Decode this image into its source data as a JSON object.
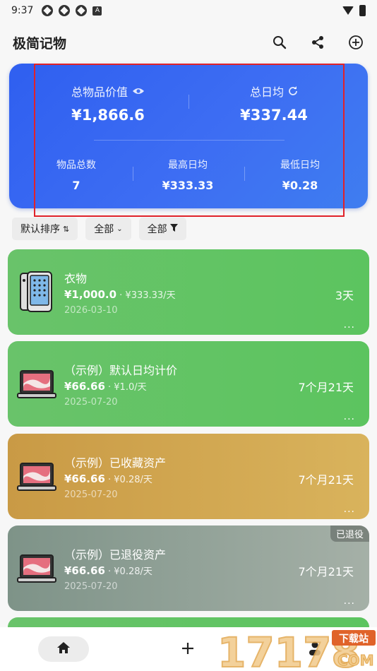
{
  "status": {
    "time": "9:37",
    "icons": [
      "app-icon",
      "app-icon",
      "app-icon",
      "a-icon",
      "wifi-icon",
      "battery-icon"
    ]
  },
  "header": {
    "title": "极简记物",
    "actions": [
      "search-icon",
      "share-icon",
      "add-circle-icon"
    ]
  },
  "summary": {
    "total_value_label": "总物品价值",
    "total_value": "¥1,866.6",
    "daily_total_label": "总日均",
    "daily_total": "¥337.44",
    "count_label": "物品总数",
    "count": "7",
    "max_daily_label": "最高日均",
    "max_daily": "¥333.33",
    "min_daily_label": "最低日均",
    "min_daily": "¥0.28"
  },
  "filters": {
    "sort": "默认排序",
    "category": "全部",
    "filter": "全部"
  },
  "items": [
    {
      "name": "衣物",
      "price": "¥1,000.0",
      "daily": " · ¥333.33/天",
      "date": "2026-03-10",
      "duration": "3天",
      "more": "...",
      "color": "green",
      "thumb": "phone-icon"
    },
    {
      "name": "（示例）默认日均计价",
      "price": "¥66.66",
      "daily": " · ¥1.0/天",
      "date": "2025-07-20",
      "duration": "7个月21天",
      "more": "...",
      "color": "green",
      "thumb": "laptop-icon"
    },
    {
      "name": "（示例）已收藏资产",
      "price": "¥66.66",
      "daily": " · ¥0.28/天",
      "date": "2025-07-20",
      "duration": "7个月21天",
      "more": "...",
      "color": "gold",
      "thumb": "laptop-icon"
    },
    {
      "name": "（示例）已退役资产",
      "price": "¥66.66",
      "daily": " · ¥0.28/天",
      "date": "2025-07-20",
      "duration": "7个月21天",
      "more": "...",
      "color": "grey",
      "thumb": "laptop-icon",
      "tag": "已退役"
    }
  ],
  "bottom_nav": [
    "home-icon",
    "add-icon",
    "person-icon"
  ],
  "watermark": {
    "text": "17178",
    "site": "下载站",
    "sub": "COM"
  }
}
